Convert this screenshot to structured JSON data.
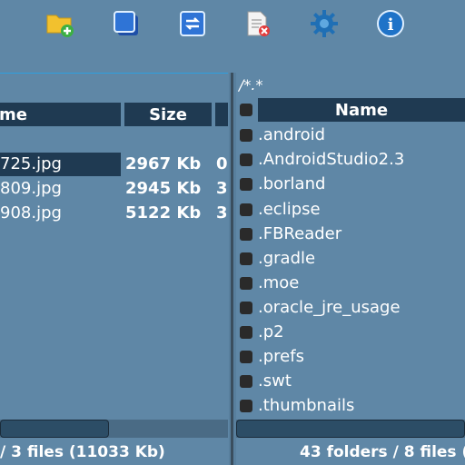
{
  "toolbar": {
    "buttons": [
      {
        "name": "new-folder",
        "icon": "folder-plus-icon"
      },
      {
        "name": "copy",
        "icon": "copy-icon"
      },
      {
        "name": "move",
        "icon": "move-icon"
      },
      {
        "name": "delete",
        "icon": "file-delete-icon"
      },
      {
        "name": "settings",
        "icon": "gear-icon"
      },
      {
        "name": "info",
        "icon": "info-icon",
        "label": "i"
      }
    ]
  },
  "left_panel": {
    "headers": {
      "name": "me",
      "size": "Size"
    },
    "files": [
      {
        "name": "725.jpg",
        "size": "2967 Kb",
        "date": "0",
        "selected": true
      },
      {
        "name": "809.jpg",
        "size": "2945 Kb",
        "date": "3",
        "selected": false
      },
      {
        "name": "908.jpg",
        "size": "5122 Kb",
        "date": "3",
        "selected": false
      }
    ],
    "status": "/ 3 files (11033 Kb)"
  },
  "right_panel": {
    "path": "/*.*",
    "headers": {
      "name": "Name"
    },
    "items": [
      ".android",
      ".AndroidStudio2.3",
      ".borland",
      ".eclipse",
      ".FBReader",
      ".gradle",
      ".moe",
      ".oracle_jre_usage",
      ".p2",
      ".prefs",
      ".swt",
      ".thumbnails"
    ],
    "status": "43 folders / 8 files ("
  },
  "colors": {
    "background": "#5f87a6",
    "header": "#1f3a52",
    "selection": "#1f3a52",
    "accent": "#2e9fe0"
  }
}
